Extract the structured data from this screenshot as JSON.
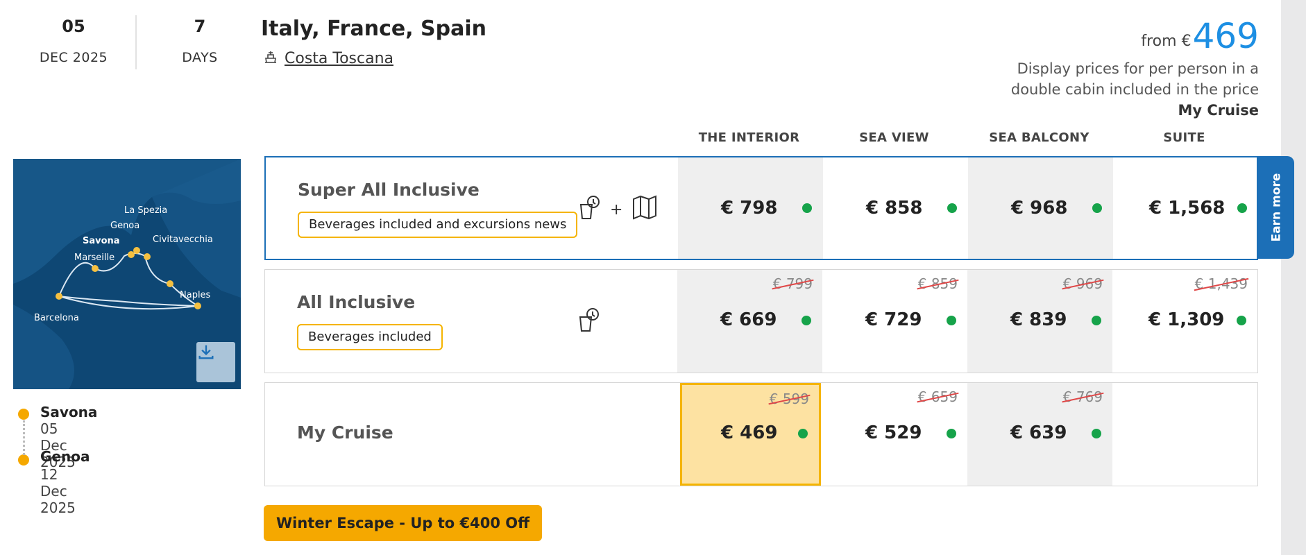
{
  "sailing": {
    "day": "05",
    "month_year": "DEC 2025",
    "days_count": "7",
    "days_label": "DAYS"
  },
  "title": "Italy, France, Spain",
  "ship_name": "Costa Toscana",
  "price_summary": {
    "from_label": "from €",
    "from_price": "469",
    "note_line1": "Display prices for per person in a",
    "note_line2": "double cabin included in the price",
    "note_fare": "My Cruise"
  },
  "map": {
    "ports": [
      "La Spezia",
      "Genoa",
      "Savona",
      "Civitavecchia",
      "Marseille",
      "Naples",
      "Barcelona"
    ],
    "download_icon": "download-icon"
  },
  "itinerary": [
    {
      "port": "Savona",
      "date": "05 Dec 2025"
    },
    {
      "port": "Genoa",
      "date": "12 Dec 2025"
    }
  ],
  "columns": [
    "THE INTERIOR",
    "SEA VIEW",
    "SEA BALCONY",
    "SUITE"
  ],
  "fares": [
    {
      "name": "Super All Inclusive",
      "badge": "Beverages included and excursions news",
      "icons": [
        "drinks-icon",
        "map-icon"
      ],
      "icon_plus": "+",
      "prices": [
        {
          "old": "",
          "price": "€ 798"
        },
        {
          "old": "",
          "price": "€ 858"
        },
        {
          "old": "",
          "price": "€ 968"
        },
        {
          "old": "",
          "price": "€ 1,568"
        }
      ]
    },
    {
      "name": "All Inclusive",
      "badge": "Beverages included",
      "icons": [
        "drinks-icon"
      ],
      "prices": [
        {
          "old": "€ 799",
          "price": "€ 669"
        },
        {
          "old": "€ 859",
          "price": "€ 729"
        },
        {
          "old": "€ 969",
          "price": "€ 839"
        },
        {
          "old": "€ 1,439",
          "price": "€ 1,309"
        }
      ]
    },
    {
      "name": "My Cruise",
      "badge": "",
      "icons": [],
      "prices": [
        {
          "old": "€ 599",
          "price": "€ 469"
        },
        {
          "old": "€ 659",
          "price": "€ 529"
        },
        {
          "old": "€ 769",
          "price": "€ 639"
        }
      ]
    }
  ],
  "earn_more": "Earn more",
  "promo": "Winter Escape - Up to €400 Off",
  "colors": {
    "accent_blue": "#1d8fe3",
    "highlight_border": "#1c6fb7",
    "badge_yellow": "#f5b400",
    "available_green": "#16a34a",
    "selected_fill": "#fde2a2"
  }
}
